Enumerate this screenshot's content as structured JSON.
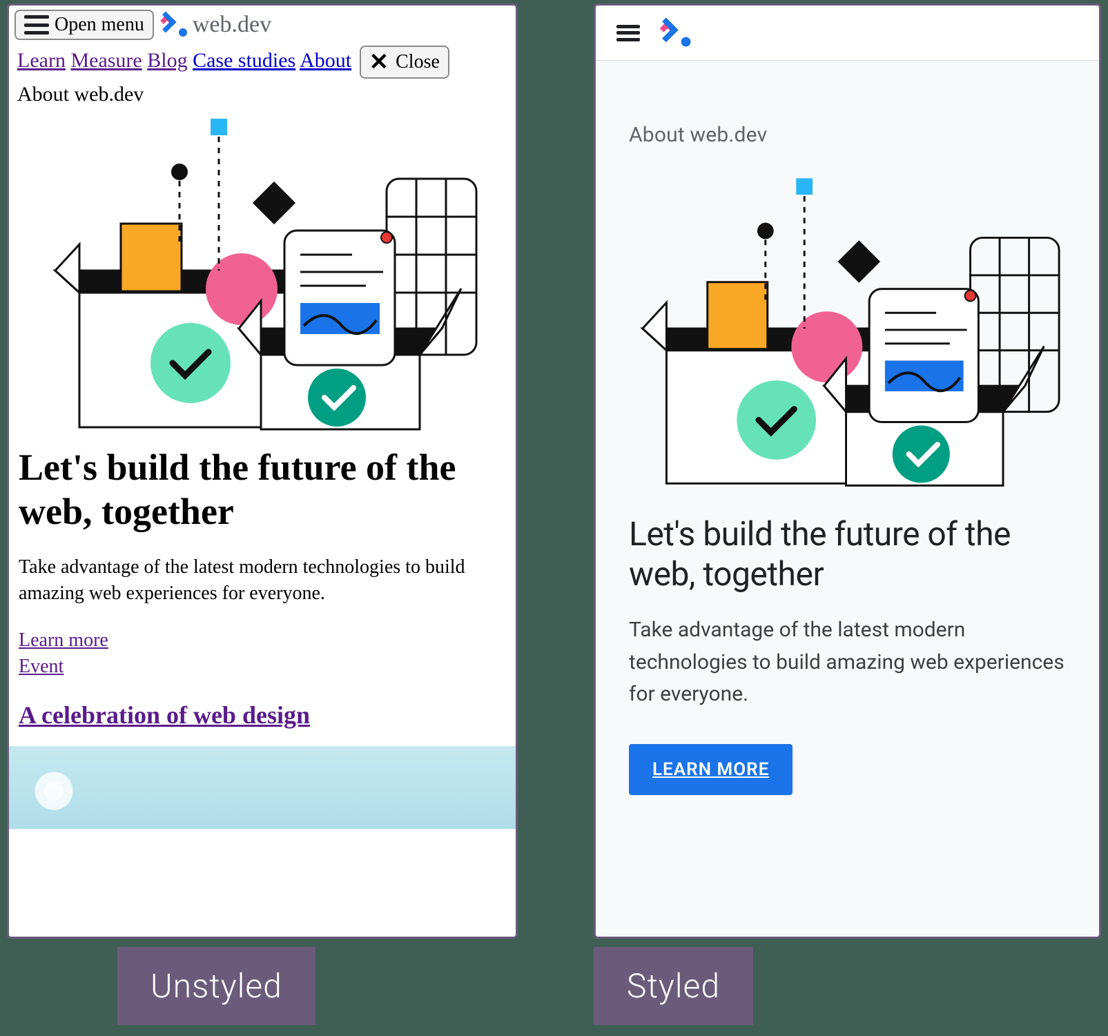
{
  "unstyled": {
    "open_menu_label": "Open menu",
    "brand_text": "web.dev",
    "nav": {
      "learn": "Learn",
      "measure": "Measure",
      "blog": "Blog",
      "case_studies": "Case studies",
      "about": "About"
    },
    "close_label": "Close",
    "caption": "About web.dev",
    "headline": "Let's build the future of the web, together",
    "subhead": "Take advantage of the latest modern technologies to build amazing web experiences for everyone.",
    "learn_more": "Learn more",
    "event_label": "Event",
    "event_title": "A celebration of web design"
  },
  "styled": {
    "eyebrow": "About web.dev",
    "headline": "Let's build the future of the web, together",
    "subhead": "Take advantage of the latest modern technologies to build amazing web experiences for everyone.",
    "cta": "LEARN MORE"
  },
  "labels": {
    "left": "Unstyled",
    "right": "Styled"
  }
}
